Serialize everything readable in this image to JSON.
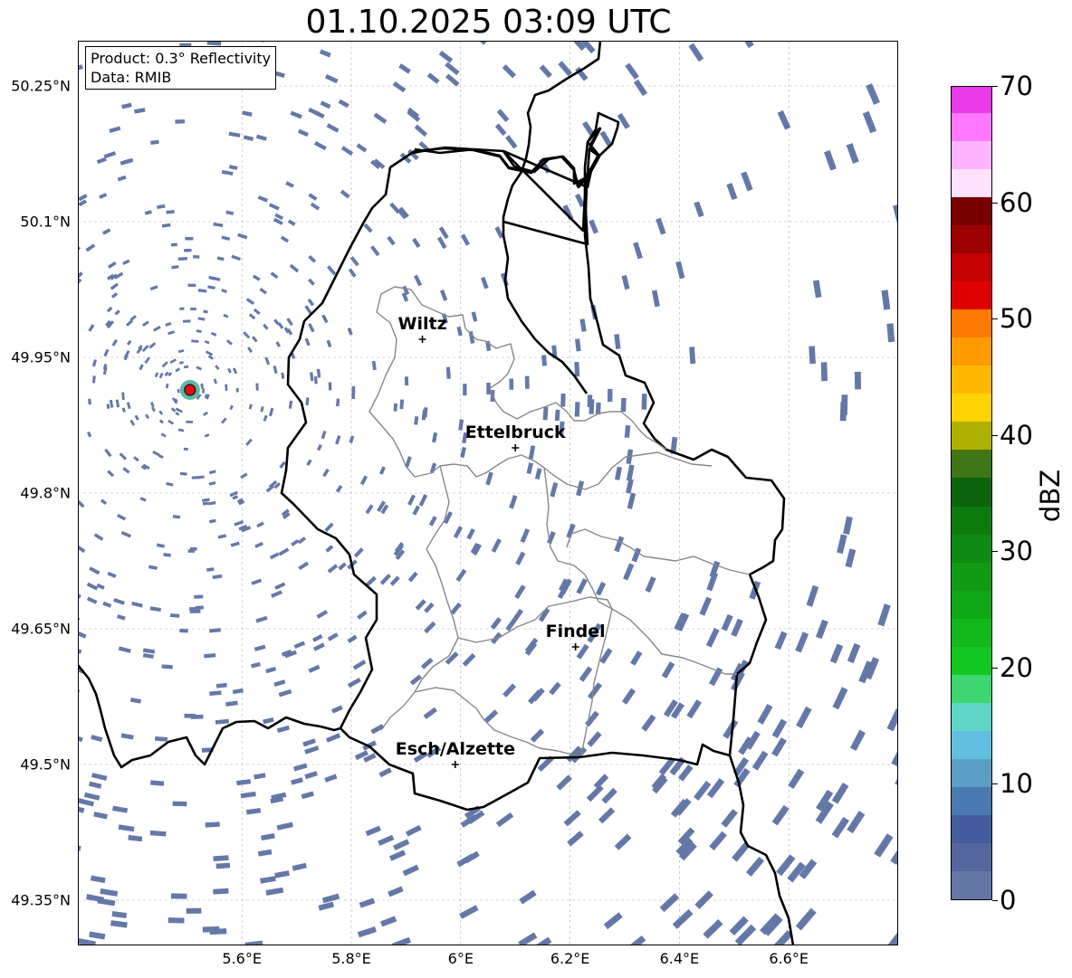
{
  "figure": {
    "title": "01.10.2025 03:09 UTC",
    "info_lines": [
      "Product: 0.3° Reflectivity",
      "Data: RMIB"
    ]
  },
  "map": {
    "lon_range": [
      5.3,
      6.8
    ],
    "lat_range": [
      49.3,
      50.3
    ],
    "lat_ticks": [
      "50.25°N",
      "50.1°N",
      "49.95°N",
      "49.8°N",
      "49.65°N",
      "49.5°N",
      "49.35°N"
    ],
    "lon_ticks": [
      "5.6°E",
      "5.8°E",
      "6°E",
      "6.2°E",
      "6.4°E",
      "6.6°E"
    ],
    "radar_site": {
      "lon": 5.505,
      "lat": 49.914,
      "color": "#dd1111"
    },
    "cities": [
      {
        "name": "Wiltz",
        "lon": 5.93,
        "lat": 49.97
      },
      {
        "name": "Ettelbruck",
        "lon": 6.1,
        "lat": 49.85
      },
      {
        "name": "Findel",
        "lon": 6.21,
        "lat": 49.63
      },
      {
        "name": "Esch/Alzette",
        "lon": 5.99,
        "lat": 49.5
      }
    ],
    "echo_color": "#6478a8",
    "border_color": "#000000",
    "canton_color": "#888888",
    "gridline_color": "#b0b0b0"
  },
  "colorbar": {
    "label": "dBZ",
    "tick_labels": [
      "0",
      "10",
      "20",
      "30",
      "40",
      "50",
      "60",
      "70"
    ],
    "min": 0,
    "max": 70,
    "step": 2.5,
    "colors": [
      "#6478a8",
      "#53679e",
      "#445c9e",
      "#4a7ab0",
      "#5a9ec6",
      "#62bede",
      "#5ed6c8",
      "#3ed670",
      "#12c820",
      "#12b81a",
      "#10a816",
      "#109a14",
      "#0f8a12",
      "#0d7a10",
      "#0b650c",
      "#417614",
      "#b0b000",
      "#ffd200",
      "#ffb800",
      "#ff9a00",
      "#ff7a00",
      "#e00000",
      "#c40000",
      "#9c0000",
      "#780000",
      "#ffe0ff",
      "#ffb4ff",
      "#ff78ff",
      "#e83ae8"
    ]
  }
}
